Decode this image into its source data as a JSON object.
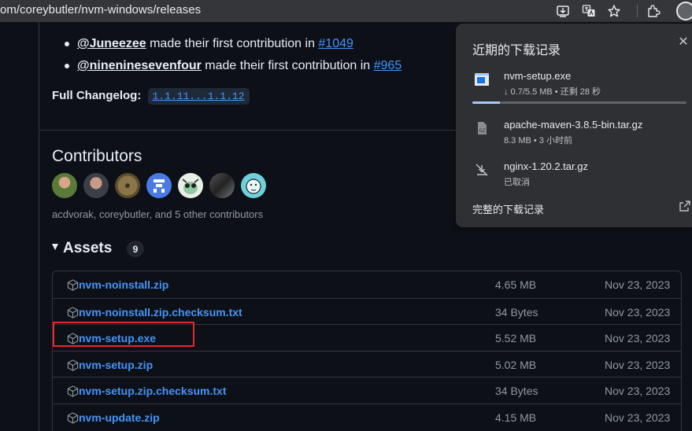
{
  "browser": {
    "url": "om/coreybutler/nvm-windows/releases",
    "icons": [
      "download-icon",
      "translate-icon",
      "bookmark-star-icon",
      "extensions-icon",
      "profile-icon"
    ]
  },
  "release": {
    "contributions": [
      {
        "user": "@Juneezee",
        "text": " made their first contribution in ",
        "pr": "#1049"
      },
      {
        "user": "@nineninesevenfour",
        "text": " made their first contribution in ",
        "pr": "#965"
      }
    ],
    "changelog_label": "Full Changelog:",
    "changelog_link": "1.1.11...1.1.12"
  },
  "contributors": {
    "title": "Contributors",
    "summary": "acdvorak, coreybutler, and 5 other contributors"
  },
  "assets": {
    "title": "Assets",
    "count": "9",
    "items": [
      {
        "name": "nvm-noinstall.zip",
        "size": "4.65 MB",
        "date": "Nov 23, 2023"
      },
      {
        "name": "nvm-noinstall.zip.checksum.txt",
        "size": "34 Bytes",
        "date": "Nov 23, 2023"
      },
      {
        "name": "nvm-setup.exe",
        "size": "5.52 MB",
        "date": "Nov 23, 2023"
      },
      {
        "name": "nvm-setup.zip",
        "size": "5.02 MB",
        "date": "Nov 23, 2023"
      },
      {
        "name": "nvm-setup.zip.checksum.txt",
        "size": "34 Bytes",
        "date": "Nov 23, 2023"
      },
      {
        "name": "nvm-update.zip",
        "size": "4.15 MB",
        "date": "Nov 23, 2023"
      }
    ]
  },
  "downloads": {
    "title": "近期的下载记录",
    "items": [
      {
        "name": "nvm-setup.exe",
        "status": "↓ 0.7/5.5 MB • 还剩 28 秒",
        "progress": 0.13
      },
      {
        "name": "apache-maven-3.8.5-bin.tar.gz",
        "status": "8.3 MB • 3 小时前",
        "icon_label": "GZ"
      },
      {
        "name": "nginx-1.20.2.tar.gz",
        "status": "已取消"
      }
    ],
    "full_history": "完整的下载记录"
  },
  "colors": {
    "link": "#4493f8",
    "highlight_border": "#e5282c",
    "progress": "#a8c7fa"
  }
}
